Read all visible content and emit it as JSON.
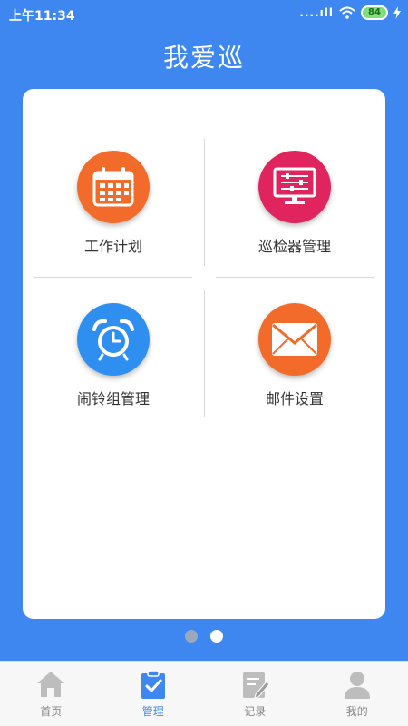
{
  "status_bar": {
    "time": "上午11:34",
    "signal": "....ıll",
    "battery": "84"
  },
  "header": {
    "title": "我爱巡"
  },
  "menu": [
    {
      "label": "工作计划",
      "icon": "calendar-icon",
      "color": "#f26b2a"
    },
    {
      "label": "巡检器管理",
      "icon": "monitor-icon",
      "color": "#e0245e"
    },
    {
      "label": "闹铃组管理",
      "icon": "alarm-clock-icon",
      "color": "#2f8ff0"
    },
    {
      "label": "邮件设置",
      "icon": "mail-icon",
      "color": "#f26b2a"
    }
  ],
  "pager": {
    "active_index": 1
  },
  "tabs": [
    {
      "label": "首页",
      "icon": "home-icon"
    },
    {
      "label": "管理",
      "icon": "clipboard-check-icon",
      "active": true
    },
    {
      "label": "记录",
      "icon": "note-edit-icon"
    },
    {
      "label": "我的",
      "icon": "user-icon"
    }
  ],
  "colors": {
    "primary": "#3e87f0",
    "divider": "#d8d8d8",
    "tab_inactive": "#888888"
  }
}
